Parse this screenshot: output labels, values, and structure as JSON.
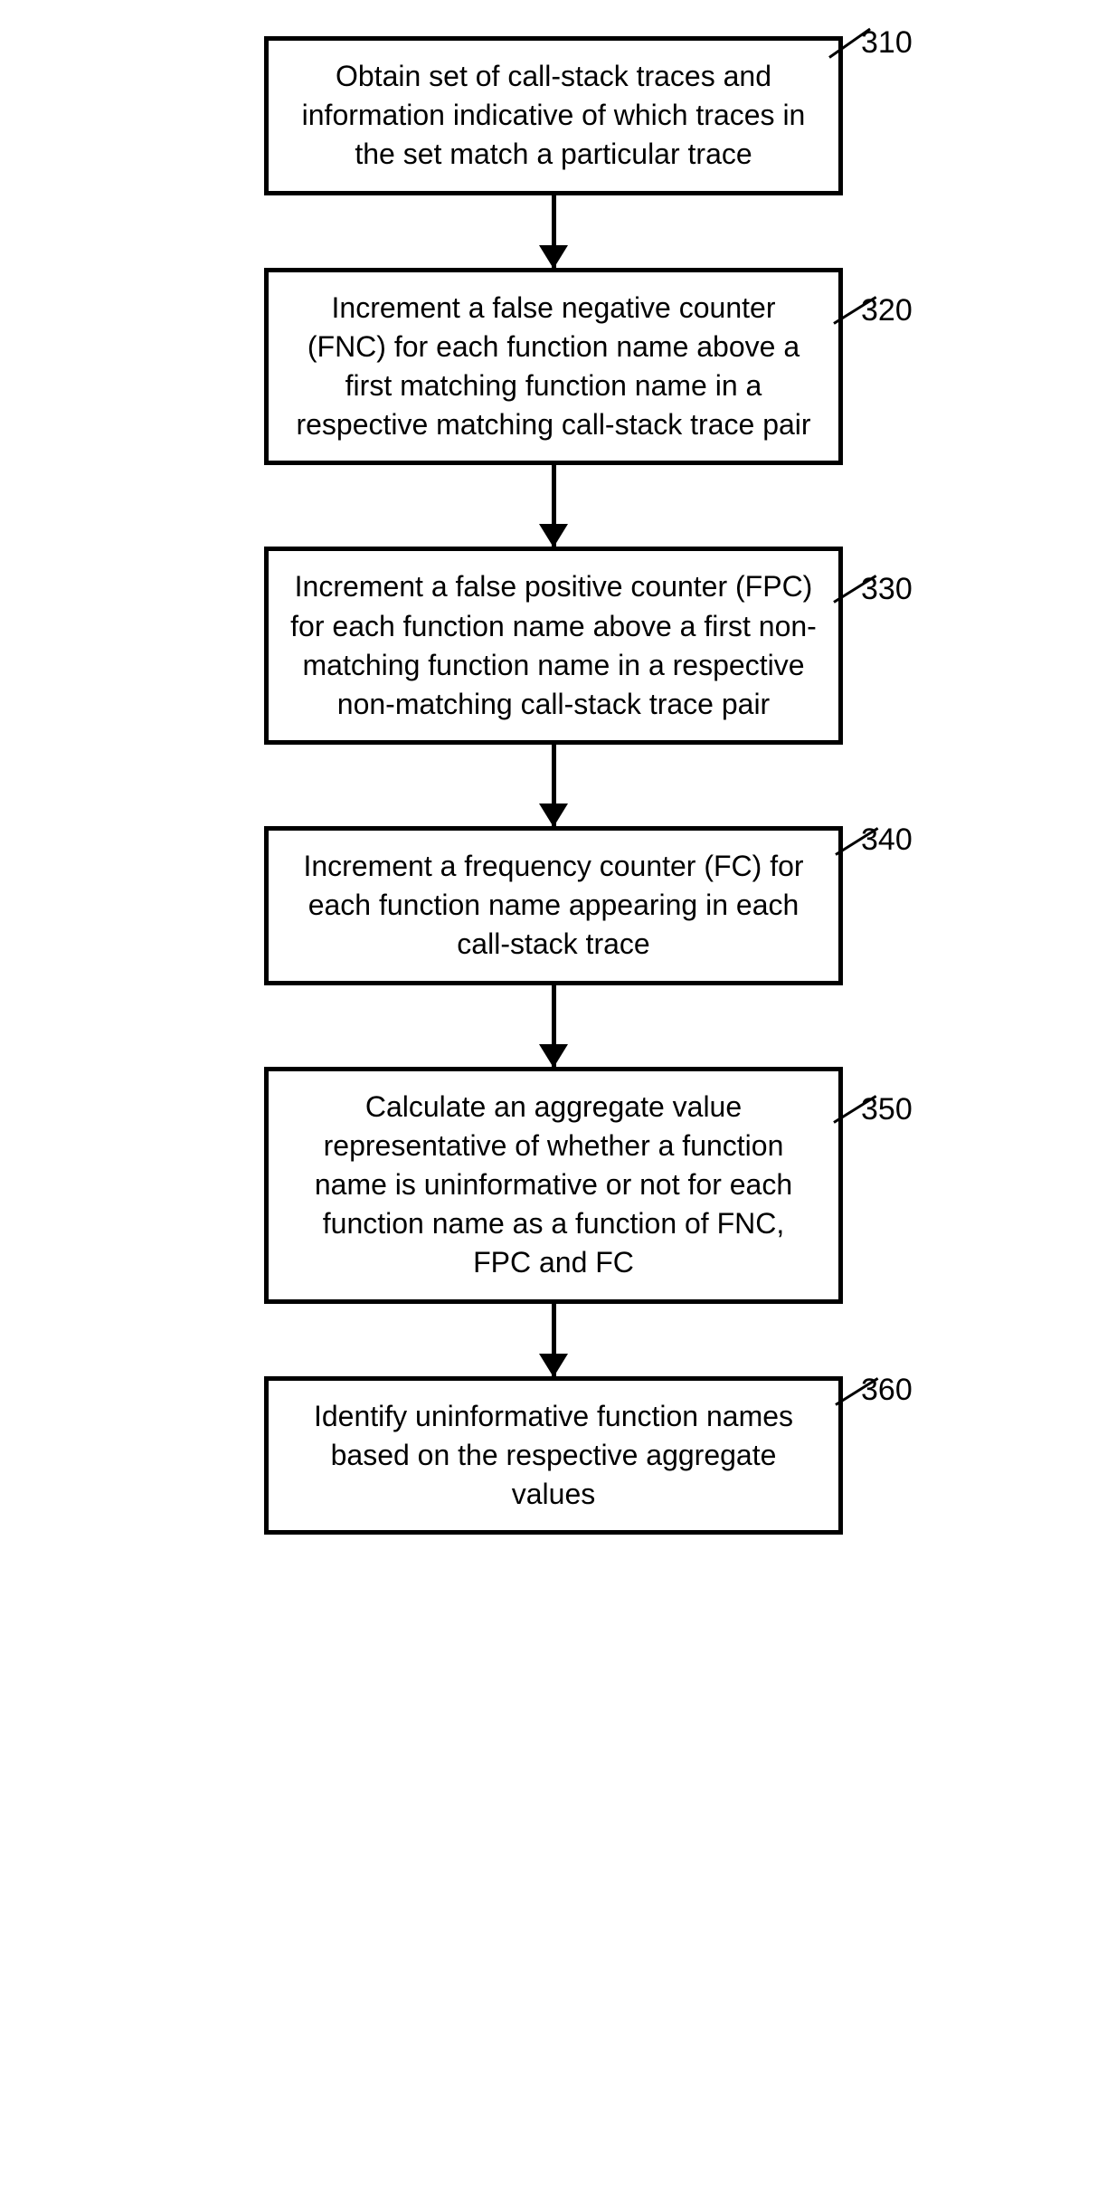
{
  "steps": [
    {
      "num": "310",
      "text": "Obtain set of call-stack traces and information indicative of which traces in the set match a particular trace"
    },
    {
      "num": "320",
      "text": "Increment a false negative counter (FNC) for each function name above a first matching function name in a respective matching call-stack trace pair"
    },
    {
      "num": "330",
      "text": "Increment a false positive counter (FPC) for each function name above a first non-matching function name in a respective non-matching call-stack trace pair"
    },
    {
      "num": "340",
      "text": "Increment a frequency counter (FC) for each function name appearing in each call-stack trace"
    },
    {
      "num": "350",
      "text": "Calculate an aggregate value representative of whether a function name is uninformative or not for each function name as a function of FNC, FPC and FC"
    },
    {
      "num": "360",
      "text": "Identify uninformative function names based on the respective aggregate values"
    }
  ]
}
